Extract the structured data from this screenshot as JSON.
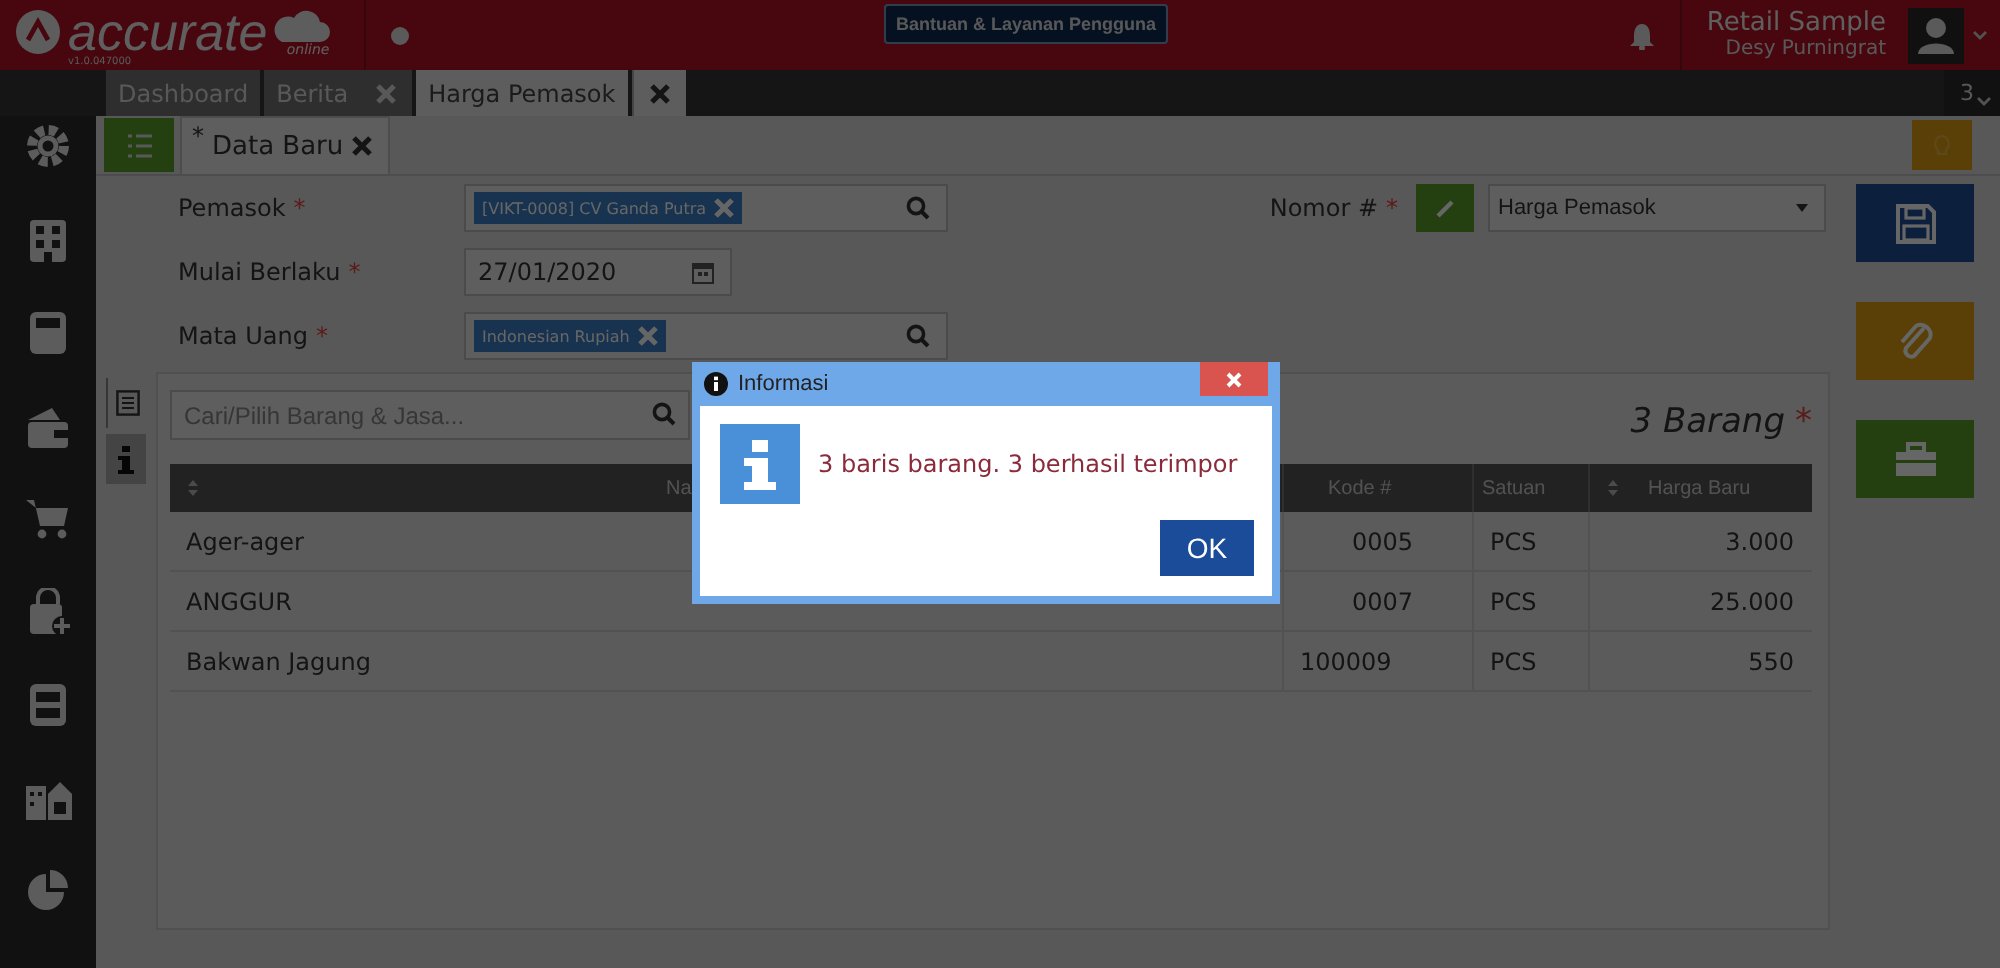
{
  "header": {
    "logo": "accurate",
    "logo_sub": "online",
    "version": "v1.0.047000",
    "help_button": "Bantuan & Layanan Pengguna",
    "company": "Retail Sample",
    "user": "Desy Purningrat"
  },
  "tabs": [
    {
      "label": "Dashboard",
      "selected": false,
      "closable": false
    },
    {
      "label": "Berita",
      "selected": false,
      "closable": true
    },
    {
      "label": "Harga Pemasok",
      "selected": true,
      "closable": true
    }
  ],
  "tab_count": "3",
  "subtab": {
    "marker": "*",
    "label": "Data Baru",
    "closable": true
  },
  "form": {
    "fields": [
      {
        "label": "Pemasok",
        "required_mark": "*",
        "kind": "tag",
        "value": "[VIKT-0008] CV Ganda Putra"
      },
      {
        "label": "Mulai Berlaku",
        "required_mark": "*",
        "kind": "date",
        "value": "27/01/2020"
      },
      {
        "label": "Mata Uang",
        "required_mark": "*",
        "kind": "tag",
        "value": "Indonesian Rupiah"
      }
    ],
    "number": {
      "label": "Nomor #",
      "required_mark": "*",
      "value": "Harga Pemasok"
    }
  },
  "detail": {
    "search": {
      "placeholder": "Cari/Pilih Barang & Jasa..."
    },
    "count": "3 Barang",
    "count_mark": "*",
    "columns": [
      "Na",
      "Kode #",
      "Satuan",
      "Harga Baru"
    ],
    "rows": [
      [
        "Ager-ager",
        "0005",
        "PCS",
        "3.000"
      ],
      [
        "ANGGUR",
        "0007",
        "PCS",
        "25.000"
      ],
      [
        "Bakwan Jagung",
        "100009",
        "PCS",
        "550"
      ]
    ]
  },
  "dialog": {
    "title": "Informasi",
    "message": "3 baris barang. 3 berhasil terimpor",
    "button": "OK"
  }
}
